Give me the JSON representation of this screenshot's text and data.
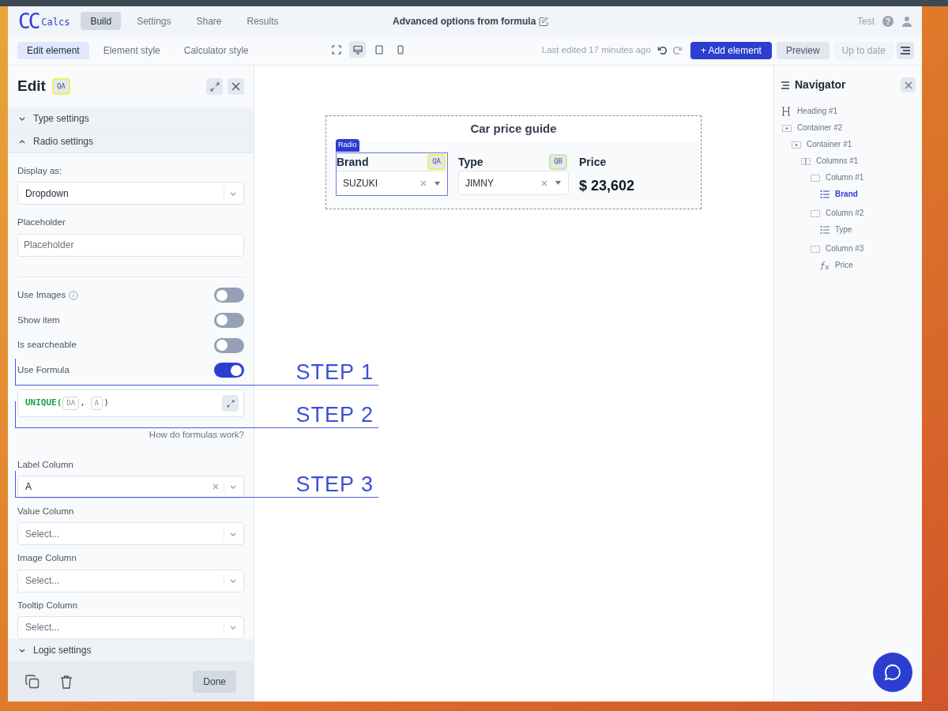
{
  "app": {
    "logo_mark": "CC",
    "logo_text": "Calcs"
  },
  "main_tabs": [
    {
      "label": "Build",
      "selected": true
    },
    {
      "label": "Settings",
      "selected": false
    },
    {
      "label": "Share",
      "selected": false
    },
    {
      "label": "Results",
      "selected": false
    }
  ],
  "document_title": "Advanced options from formula",
  "user": {
    "name": "Test"
  },
  "sub_tabs": [
    {
      "label": "Edit element",
      "selected": true
    },
    {
      "label": "Element style",
      "selected": false
    },
    {
      "label": "Calculator style",
      "selected": false
    }
  ],
  "device_views": [
    {
      "kind": "fullscreen",
      "selected": false
    },
    {
      "kind": "desktop",
      "selected": true
    },
    {
      "kind": "tablet",
      "selected": false
    },
    {
      "kind": "mobile",
      "selected": false
    }
  ],
  "last_edited": "Last edited 17 minutes ago",
  "actions": {
    "add": "+ Add element",
    "preview": "Preview",
    "status": "Up to date"
  },
  "edit_panel": {
    "title": "Edit",
    "badge": "QA",
    "sections": [
      {
        "label": "Type settings",
        "expanded": false
      },
      {
        "label": "Radio settings",
        "expanded": true
      }
    ],
    "display_as": {
      "label": "Display as:",
      "value": "Dropdown"
    },
    "placeholder_field": {
      "label": "Placeholder",
      "placeholder": "Placeholder"
    },
    "toggles": [
      {
        "label": "Use Images",
        "info": true,
        "on": false
      },
      {
        "label": "Show item",
        "info": false,
        "on": false
      },
      {
        "label": "Is searcheable",
        "info": false,
        "on": false
      },
      {
        "label": "Use Formula",
        "info": false,
        "on": true
      }
    ],
    "formula": {
      "function": "UNIQUE(",
      "args": [
        "DA",
        "A"
      ],
      "separator": ",",
      "close": ")"
    },
    "help_link": "How do formulas work?",
    "selects": [
      {
        "label": "Label Column",
        "value": "A"
      },
      {
        "label": "Value Column",
        "placeholder": "Select..."
      },
      {
        "label": "Image Column",
        "placeholder": "Select..."
      },
      {
        "label": "Tooltip Column",
        "placeholder": "Select..."
      }
    ],
    "logic_section": {
      "label": "Logic settings",
      "expanded": false
    },
    "done": "Done"
  },
  "canvas": {
    "title": "Car price guide",
    "element_tag": "Radio",
    "fields": [
      {
        "kind": "select",
        "label": "Brand",
        "badge": "QA",
        "color": "#f0f05a",
        "value": "SUZUKI",
        "selected": true
      },
      {
        "kind": "select",
        "label": "Type",
        "badge": "QB",
        "color": "#cde9a0",
        "value": "JIMNY",
        "selected": false
      },
      {
        "kind": "output",
        "label": "Price",
        "value": "$ 23,602"
      }
    ]
  },
  "navigator": {
    "title": "Navigator",
    "tree": [
      {
        "kind": "heading",
        "label": "Heading #1",
        "selected": false
      },
      {
        "kind": "container",
        "label": "Container #2",
        "selected": false,
        "children": [
          {
            "kind": "container",
            "label": "Container #1",
            "selected": false,
            "children": [
              {
                "kind": "columns",
                "label": "Columns #1",
                "selected": false,
                "children": [
                  {
                    "kind": "column",
                    "label": "Column #1",
                    "selected": false,
                    "children": [
                      {
                        "kind": "list",
                        "label": "Brand",
                        "selected": true
                      }
                    ]
                  },
                  {
                    "kind": "column",
                    "label": "Column #2",
                    "selected": false,
                    "children": [
                      {
                        "kind": "list",
                        "label": "Type",
                        "selected": false
                      }
                    ]
                  },
                  {
                    "kind": "column",
                    "label": "Column #3",
                    "selected": false,
                    "children": [
                      {
                        "kind": "formula",
                        "label": "Price",
                        "selected": false
                      }
                    ]
                  }
                ]
              }
            ]
          }
        ]
      }
    ]
  },
  "annotations": [
    {
      "label": "STEP 1"
    },
    {
      "label": "STEP 2"
    },
    {
      "label": "STEP 3"
    }
  ]
}
